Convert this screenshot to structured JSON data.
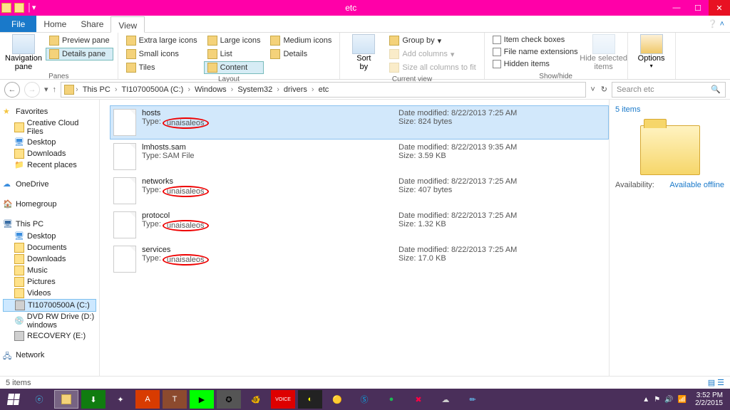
{
  "window": {
    "title": "etc"
  },
  "menutabs": {
    "file": "File",
    "home": "Home",
    "share": "Share",
    "view": "View"
  },
  "ribbon": {
    "panes_large": "Navigation\npane",
    "preview": "Preview pane",
    "details_pane": "Details pane",
    "group_panes": "Panes",
    "xl": "Extra large icons",
    "lg": "Large icons",
    "md": "Medium icons",
    "sm": "Small icons",
    "list": "List",
    "detailsv": "Details",
    "tiles": "Tiles",
    "content": "Content",
    "group_layout": "Layout",
    "sortby": "Sort\nby",
    "groupby": "Group by",
    "addcols": "Add columns",
    "sizecols": "Size all columns to fit",
    "group_current": "Current view",
    "itemcb": "Item check boxes",
    "fileext": "File name extensions",
    "hidden": "Hidden items",
    "hidesel": "Hide selected\nitems",
    "group_showhide": "Show/hide",
    "options": "Options"
  },
  "breadcrumbs": [
    "This PC",
    "TI10700500A (C:)",
    "Windows",
    "System32",
    "drivers",
    "etc"
  ],
  "search_placeholder": "Search etc",
  "nav": {
    "fav": "Favorites",
    "fav_items": [
      "Creative Cloud Files",
      "Desktop",
      "Downloads",
      "Recent places"
    ],
    "onedrive": "OneDrive",
    "homegroup": "Homegroup",
    "pc": "This PC",
    "pc_items": [
      "Desktop",
      "Documents",
      "Downloads",
      "Music",
      "Pictures",
      "Videos",
      "TI10700500A (C:)",
      "DVD RW Drive (D:) windows",
      "RECOVERY (E:)"
    ],
    "network": "Network"
  },
  "files": [
    {
      "name": "hosts",
      "type_prefix": "Type:",
      "type": "unaisaleos",
      "dm_label": "Date modified:",
      "dm": "8/22/2013 7:25 AM",
      "size_label": "Size:",
      "size": "824 bytes",
      "circled": true,
      "selected": true
    },
    {
      "name": "lmhosts.sam",
      "type_prefix": "Type:",
      "type": "SAM File",
      "dm_label": "Date modified:",
      "dm": "8/22/2013 9:35 AM",
      "size_label": "Size:",
      "size": "3.59 KB",
      "circled": false,
      "selected": false
    },
    {
      "name": "networks",
      "type_prefix": "Type:",
      "type": "unaisaleos",
      "dm_label": "Date modified:",
      "dm": "8/22/2013 7:25 AM",
      "size_label": "Size:",
      "size": "407 bytes",
      "circled": true,
      "selected": false
    },
    {
      "name": "protocol",
      "type_prefix": "Type:",
      "type": "unaisaleos",
      "dm_label": "Date modified:",
      "dm": "8/22/2013 7:25 AM",
      "size_label": "Size:",
      "size": "1.32 KB",
      "circled": true,
      "selected": false
    },
    {
      "name": "services",
      "type_prefix": "Type:",
      "type": "unaisaleos",
      "dm_label": "Date modified:",
      "dm": "8/22/2013 7:25 AM",
      "size_label": "Size:",
      "size": "17.0 KB",
      "circled": true,
      "selected": false
    }
  ],
  "details": {
    "count": "5 items",
    "avail_label": "Availability:",
    "avail_value": "Available offline"
  },
  "status": {
    "left": "5 items"
  },
  "tray": {
    "time": "3:52 PM",
    "date": "2/2/2015"
  }
}
